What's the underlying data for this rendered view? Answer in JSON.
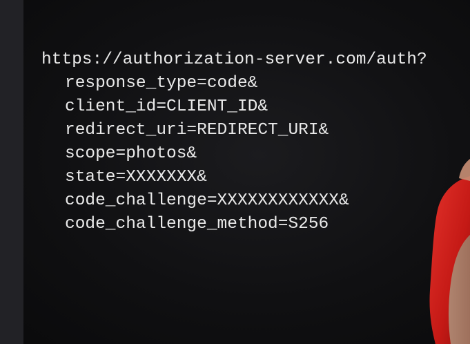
{
  "slide": {
    "lines": [
      "https://authorization-server.com/auth?",
      "response_type=code&",
      "client_id=CLIENT_ID&",
      "redirect_uri=REDIRECT_URI&",
      "scope=photos&",
      "state=XXXXXXX&",
      "code_challenge=XXXXXXXXXXXX&",
      "code_challenge_method=S256"
    ]
  },
  "colors": {
    "background": "#101012",
    "text": "#eaeaea",
    "left_bar": "#222226",
    "shirt": "#d81f1c"
  }
}
